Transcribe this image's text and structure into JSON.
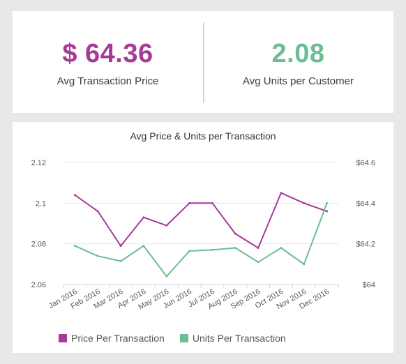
{
  "kpis": [
    {
      "value": "$ 64.36",
      "label": "Avg Transaction Price",
      "color": "#a73a96"
    },
    {
      "value": "2.08",
      "label": "Avg Units per Customer",
      "color": "#6cbc94"
    }
  ],
  "chart_data": {
    "type": "line",
    "title": "Avg Price & Units per Transaction",
    "categories": [
      "Jan 2016",
      "Feb 2016",
      "Mar 2016",
      "Apr 2016",
      "May 2016",
      "Jun 2016",
      "Jul 2016",
      "Aug 2016",
      "Sep 2016",
      "Oct 2016",
      "Nov 2016",
      "Dec 2016"
    ],
    "series": [
      {
        "name": "Price Per Transaction",
        "axis": "right",
        "color": "#a73a96",
        "values": [
          64.44,
          64.36,
          64.19,
          64.33,
          64.29,
          64.4,
          64.4,
          64.25,
          64.18,
          64.45,
          64.4,
          64.36
        ]
      },
      {
        "name": "Units Per Transaction",
        "axis": "left",
        "color": "#6cbc94",
        "values": [
          2.079,
          2.074,
          2.0715,
          2.079,
          2.064,
          2.0765,
          2.077,
          2.078,
          2.071,
          2.078,
          2.07,
          2.1
        ]
      }
    ],
    "y_left": {
      "min": 2.06,
      "max": 2.12,
      "ticks": [
        "2.06",
        "2.08",
        "2.1",
        "2.12"
      ]
    },
    "y_right": {
      "min": 64,
      "max": 64.6,
      "ticks": [
        "$64",
        "$64.2",
        "$64.4",
        "$64.6"
      ]
    },
    "grid": true,
    "legend": "bottom-left"
  }
}
